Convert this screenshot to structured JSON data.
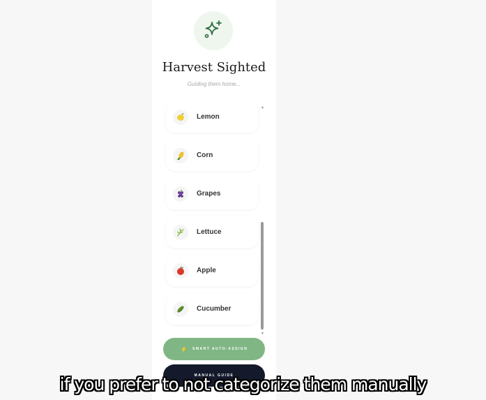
{
  "app": {
    "title": "Harvest Sighted",
    "subtitle": "Guiding them home...",
    "icon": "sparkles-icon",
    "accent": "#80b684"
  },
  "items": [
    {
      "label": "Lemon",
      "icon": "lemon-icon",
      "color": "#f2cf3a"
    },
    {
      "label": "Corn",
      "icon": "corn-icon",
      "color": "#f0c030"
    },
    {
      "label": "Grapes",
      "icon": "grapes-icon",
      "color": "#6a3d9a"
    },
    {
      "label": "Lettuce",
      "icon": "lettuce-icon",
      "color": "#8cbf4a"
    },
    {
      "label": "Apple",
      "icon": "apple-icon",
      "color": "#d93a2b"
    },
    {
      "label": "Cucumber",
      "icon": "cucumber-icon",
      "color": "#5a8a2a"
    }
  ],
  "buttons": {
    "auto_assign": "SMART AUTO-ASSIGN",
    "manual_guide": "MANUAL GUIDE"
  },
  "caption": "if you prefer to not categorize them manually"
}
